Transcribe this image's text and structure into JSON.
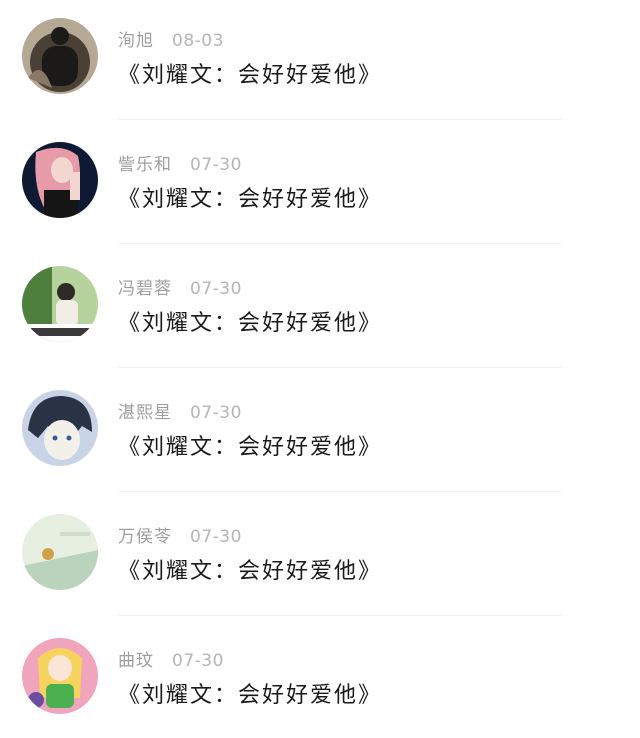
{
  "comments": [
    {
      "user": "洵旭",
      "date": "08-03",
      "text": "《刘耀文：会好好爱他》",
      "avatar_icon": "dark-hair-avatar-icon",
      "avatar_colors": [
        "#4b4036",
        "#1c1a18",
        "#8a7866"
      ]
    },
    {
      "user": "訾乐和",
      "date": "07-30",
      "text": "《刘耀文：会好好爱他》",
      "avatar_icon": "pink-hair-girl-avatar-icon",
      "avatar_colors": [
        "#0e1a33",
        "#e79aa8",
        "#f3d6cf"
      ]
    },
    {
      "user": "冯碧蓉",
      "date": "07-30",
      "text": "《刘耀文：会好好爱他》",
      "avatar_icon": "green-photo-avatar-icon",
      "avatar_colors": [
        "#b7d39d",
        "#4f7f3c",
        "#f2eee6"
      ]
    },
    {
      "user": "湛熙星",
      "date": "07-30",
      "text": "《刘耀文：会好好爱他》",
      "avatar_icon": "anime-boy-avatar-icon",
      "avatar_colors": [
        "#2a3246",
        "#c9d3e6",
        "#f3efe9"
      ]
    },
    {
      "user": "万侯苓",
      "date": "07-30",
      "text": "《刘耀文：会好好爱他》",
      "avatar_icon": "pale-green-photo-avatar-icon",
      "avatar_colors": [
        "#e7efe0",
        "#b9d3bd",
        "#d2a04b"
      ]
    },
    {
      "user": "曲玟",
      "date": "07-30",
      "text": "《刘耀文：会好好爱他》",
      "avatar_icon": "colorful-anime-avatar-icon",
      "avatar_colors": [
        "#f0a5bd",
        "#4caf50",
        "#f6d25e"
      ]
    }
  ]
}
